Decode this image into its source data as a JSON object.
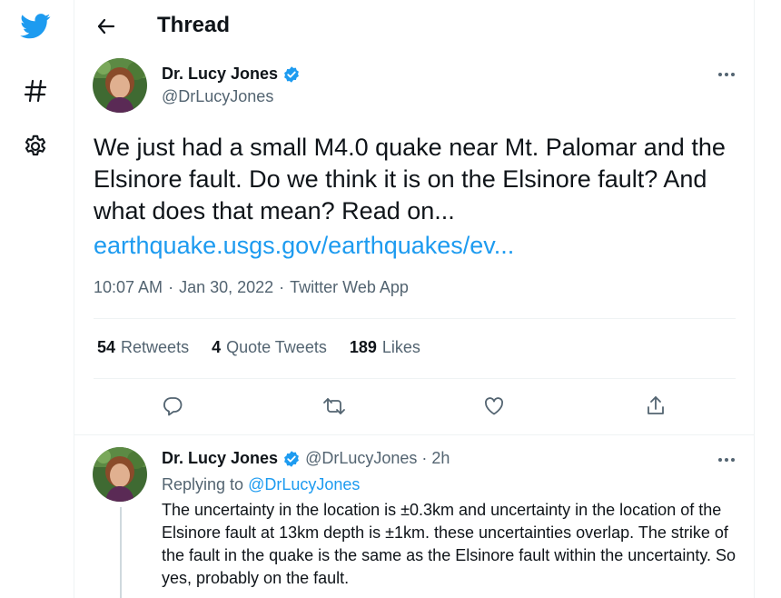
{
  "nav": {
    "icons": [
      "twitter-bird-icon",
      "hashtag-icon",
      "settings-gear-icon"
    ]
  },
  "header": {
    "back_icon": "back-arrow-icon",
    "title": "Thread"
  },
  "tweet": {
    "author_name": "Dr. Lucy Jones",
    "handle": "@DrLucyJones",
    "text": "We just had a small M4.0 quake near Mt. Palomar and the Elsinore fault. Do we think it is on the Elsinore fault? And what does that mean? Read on...",
    "link": "earthquake.usgs.gov/earthquakes/ev...",
    "time": "10:07 AM",
    "date": "Jan 30, 2022",
    "source": "Twitter Web App",
    "separator": "·",
    "stats": {
      "retweets_count": "54",
      "retweets_label": "Retweets",
      "quotes_count": "4",
      "quotes_label": "Quote Tweets",
      "likes_count": "189",
      "likes_label": "Likes"
    },
    "actions": [
      "reply-icon",
      "retweet-icon",
      "like-icon",
      "share-icon"
    ]
  },
  "reply": {
    "author_name": "Dr. Lucy Jones",
    "handle": "@DrLucyJones",
    "separator": "·",
    "age": "2h",
    "replying_to_label": "Replying to",
    "replying_to_handle": "@DrLucyJones",
    "text": "The uncertainty in the location is ±0.3km and uncertainty in the location of the Elsinore fault at 13km depth is ±1km. these uncertainties overlap. The strike of the fault in the quake is the same as the Elsinore fault within the uncertainty. So yes, probably on the fault."
  },
  "colors": {
    "accent": "#1d9bf0",
    "text": "#0f1419",
    "secondary": "#536471",
    "divider": "#eff3f4"
  }
}
